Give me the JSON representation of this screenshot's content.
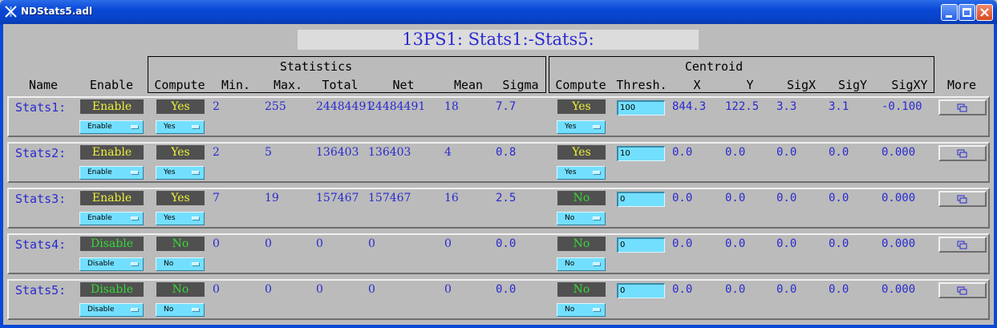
{
  "window": {
    "title": "NDStats5.adl"
  },
  "header": {
    "title": "13PS1: Stats1:-Stats5:"
  },
  "groups": {
    "statistics": "Statistics",
    "centroid": "Centroid"
  },
  "columns": {
    "name": "Name",
    "enable": "Enable",
    "stat_compute": "Compute",
    "min": "Min.",
    "max": "Max.",
    "total": "Total",
    "net": "Net",
    "mean": "Mean",
    "sigma": "Sigma",
    "cent_compute": "Compute",
    "thresh": "Thresh.",
    "x": "X",
    "y": "Y",
    "sigx": "SigX",
    "sigy": "SigY",
    "sigxy": "SigXY",
    "more": "More"
  },
  "colors": {
    "on": "#f0f03a",
    "off": "#38d838",
    "value": "#2a2ad0",
    "menu": "#73dfff"
  },
  "rows": [
    {
      "name": "Stats1:",
      "enable_readback": "Enable",
      "enable_menu": "Enable",
      "stat_compute_readback": "Yes",
      "stat_compute_menu": "Yes",
      "min": "2",
      "max": "255",
      "total": "24484491",
      "net": "24484491",
      "mean": "18",
      "sigma": "7.7",
      "cent_compute_readback": "Yes",
      "cent_compute_menu": "Yes",
      "thresh": "100",
      "x": "844.3",
      "y": "122.5",
      "sigx": "3.3",
      "sigy": "3.1",
      "sigxy": "-0.100"
    },
    {
      "name": "Stats2:",
      "enable_readback": "Enable",
      "enable_menu": "Enable",
      "stat_compute_readback": "Yes",
      "stat_compute_menu": "Yes",
      "min": "2",
      "max": "5",
      "total": "136403",
      "net": "136403",
      "mean": "4",
      "sigma": "0.8",
      "cent_compute_readback": "Yes",
      "cent_compute_menu": "Yes",
      "thresh": "10",
      "x": "0.0",
      "y": "0.0",
      "sigx": "0.0",
      "sigy": "0.0",
      "sigxy": "0.000"
    },
    {
      "name": "Stats3:",
      "enable_readback": "Enable",
      "enable_menu": "Enable",
      "stat_compute_readback": "Yes",
      "stat_compute_menu": "Yes",
      "min": "7",
      "max": "19",
      "total": "157467",
      "net": "157467",
      "mean": "16",
      "sigma": "2.5",
      "cent_compute_readback": "No",
      "cent_compute_menu": "No",
      "thresh": "0",
      "x": "0.0",
      "y": "0.0",
      "sigx": "0.0",
      "sigy": "0.0",
      "sigxy": "0.000"
    },
    {
      "name": "Stats4:",
      "enable_readback": "Disable",
      "enable_menu": "Disable",
      "stat_compute_readback": "No",
      "stat_compute_menu": "No",
      "min": "0",
      "max": "0",
      "total": "0",
      "net": "0",
      "mean": "0",
      "sigma": "0.0",
      "cent_compute_readback": "No",
      "cent_compute_menu": "No",
      "thresh": "0",
      "x": "0.0",
      "y": "0.0",
      "sigx": "0.0",
      "sigy": "0.0",
      "sigxy": "0.000"
    },
    {
      "name": "Stats5:",
      "enable_readback": "Disable",
      "enable_menu": "Disable",
      "stat_compute_readback": "No",
      "stat_compute_menu": "No",
      "min": "0",
      "max": "0",
      "total": "0",
      "net": "0",
      "mean": "0",
      "sigma": "0.0",
      "cent_compute_readback": "No",
      "cent_compute_menu": "No",
      "thresh": "0",
      "x": "0.0",
      "y": "0.0",
      "sigx": "0.0",
      "sigy": "0.0",
      "sigxy": "0.000"
    }
  ],
  "icons": {
    "app": "app-icon",
    "more": "related-display-icon"
  }
}
